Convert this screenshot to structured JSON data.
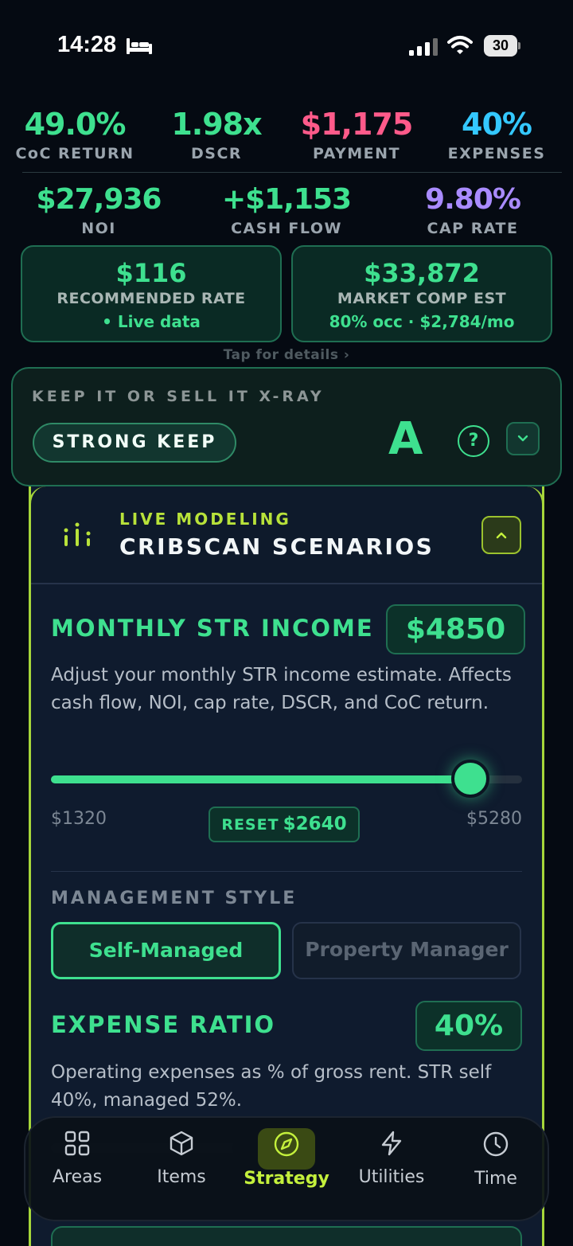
{
  "status_bar": {
    "time": "14:28",
    "battery": "30"
  },
  "metrics_row1": [
    {
      "value": "49.0%",
      "label": "CoC RETURN",
      "color": "#3ee08f"
    },
    {
      "value": "1.98x",
      "label": "DSCR",
      "color": "#3ee08f"
    },
    {
      "value": "$1,175",
      "label": "PAYMENT",
      "color": "#ff5a8a"
    },
    {
      "value": "40%",
      "label": "EXPENSES",
      "color": "#34c8ff"
    }
  ],
  "metrics_row2": [
    {
      "value": "$27,936",
      "label": "NOI",
      "color": "#3ee08f"
    },
    {
      "value": "+$1,153",
      "label": "CASH FLOW",
      "color": "#3ee08f"
    },
    {
      "value": "9.80%",
      "label": "CAP RATE",
      "color": "#a98bff"
    }
  ],
  "rate_card": {
    "value": "$116",
    "label": "RECOMMENDED RATE",
    "sub": "• Live data"
  },
  "comp_card": {
    "value": "$33,872",
    "label": "MARKET COMP EST",
    "sub": "80% occ · $2,784/mo"
  },
  "tap_hint": "Tap for details ›",
  "xray": {
    "title": "KEEP IT OR SELL IT X-RAY",
    "verdict": "STRONG KEEP",
    "grade": "A",
    "help": "?"
  },
  "scenarios": {
    "live_label": "LIVE MODELING",
    "title": "CRIBSCAN SCENARIOS",
    "income": {
      "title": "MONTHLY STR INCOME",
      "value": "$4850",
      "description": "Adjust your monthly STR income estimate. Affects cash flow, NOI, cap rate, DSCR, and CoC return.",
      "min_label": "$1320",
      "max_label": "$5280",
      "reset_prefix": "RESET",
      "reset_value": "$2640",
      "slider_fraction": 0.891
    },
    "management": {
      "title": "MANAGEMENT STYLE",
      "options": [
        "Self-Managed",
        "Property Manager"
      ],
      "selected": "Self-Managed"
    },
    "expense": {
      "title": "EXPENSE RATIO",
      "value": "40%",
      "description": "Operating expenses as % of gross rent. STR self 40%, managed 52%."
    }
  },
  "nav": [
    {
      "label": "Areas",
      "icon": "grid-icon"
    },
    {
      "label": "Items",
      "icon": "cube-icon"
    },
    {
      "label": "Strategy",
      "icon": "compass-icon",
      "active": true
    },
    {
      "label": "Utilities",
      "icon": "bolt-icon"
    },
    {
      "label": "Time",
      "icon": "clock-icon"
    }
  ],
  "colors": {
    "accent_green": "#3ee08f",
    "accent_lime": "#b8e23a",
    "background": "#050a12"
  }
}
